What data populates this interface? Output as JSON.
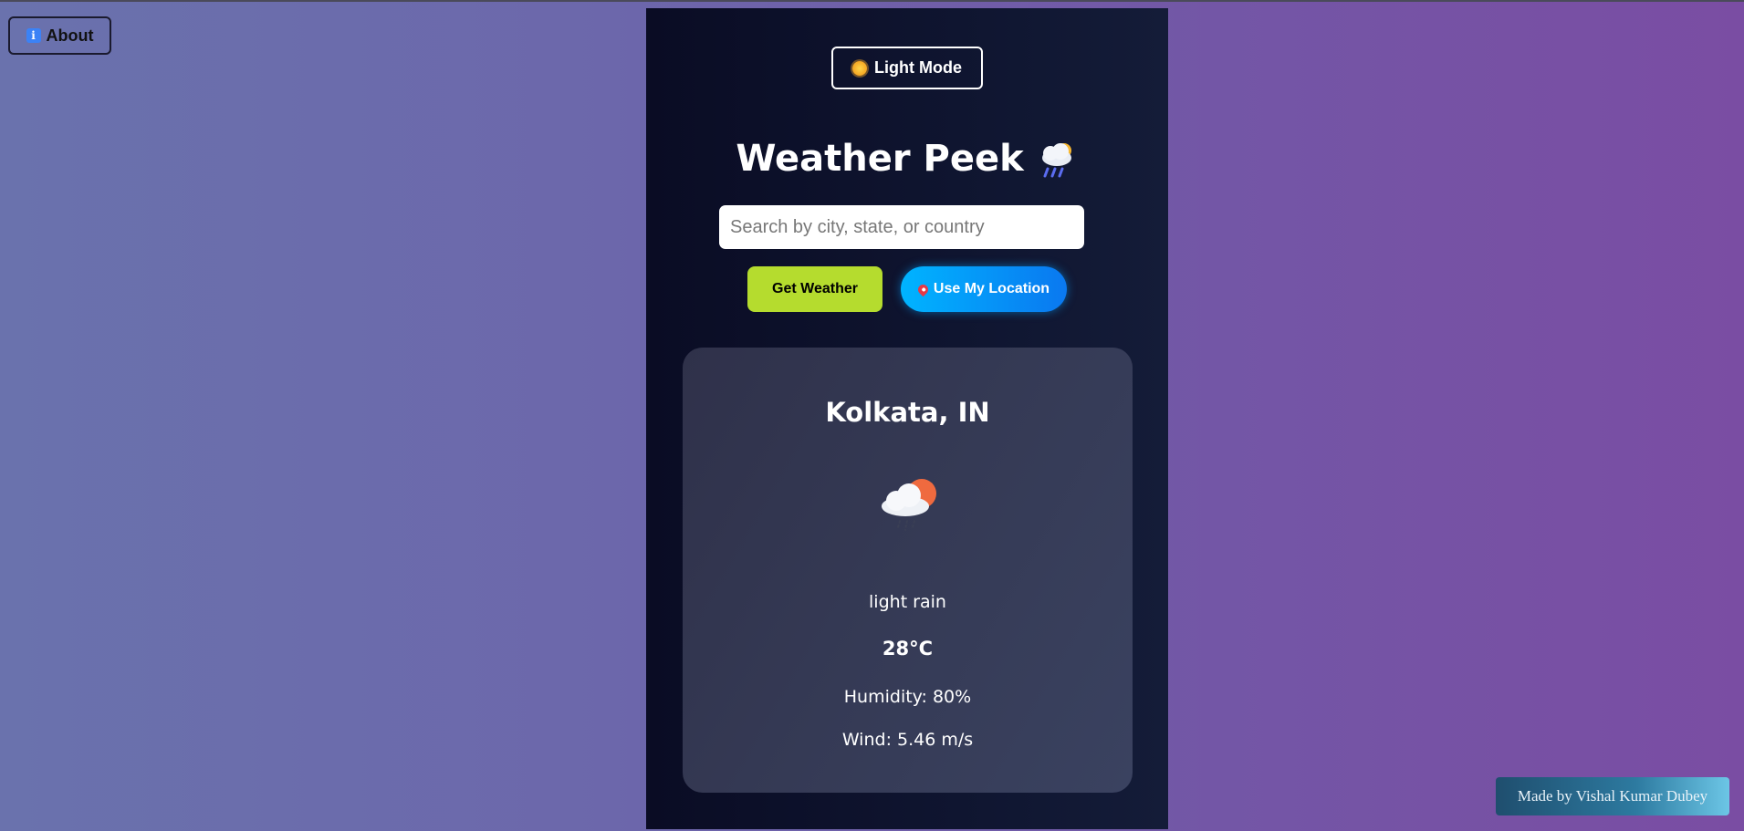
{
  "about": {
    "label": "About",
    "icon": "info-icon"
  },
  "mode_toggle": {
    "label": "Light Mode",
    "icon": "sun-icon"
  },
  "app": {
    "title": "Weather Peek",
    "title_icon": "cloud-rain-icon"
  },
  "search": {
    "placeholder": "Search by city, state, or country",
    "value": ""
  },
  "actions": {
    "get_weather_label": "Get Weather",
    "use_location_label": "Use My Location",
    "use_location_icon": "pin-icon"
  },
  "weather": {
    "city": "Kolkata, IN",
    "icon": "sun-behind-rain-cloud-icon",
    "description": "light rain",
    "temperature": "28°C",
    "humidity": "Humidity: 80%",
    "wind": "Wind: 5.46 m/s"
  },
  "footer": {
    "credit": "Made by Vishal Kumar Dubey"
  },
  "colors": {
    "accent_green": "#b5dc2e",
    "accent_blue": "#0a78f0",
    "panel_bg": "#0f1530",
    "card_bg": "#353a55"
  }
}
